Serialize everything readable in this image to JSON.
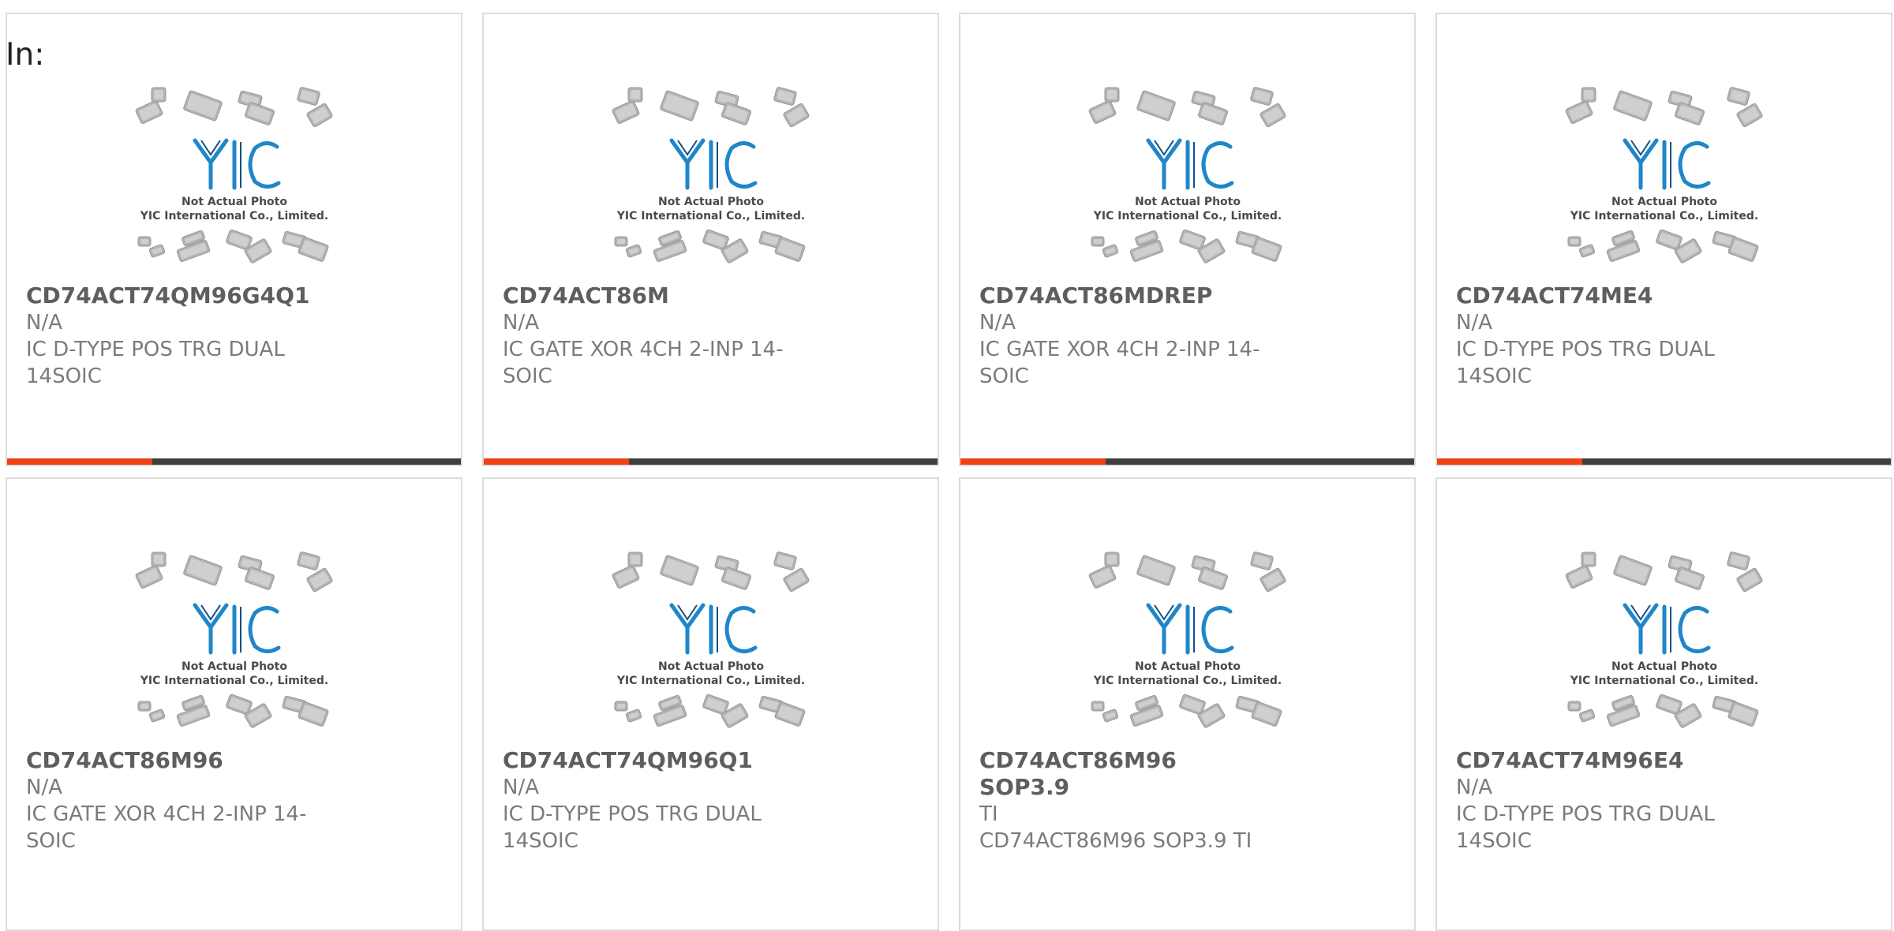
{
  "header": {
    "label": "In:"
  },
  "colors": {
    "accent": "#ee4215",
    "bar": "#3f3f3f",
    "logo_blue": "#1f86c8",
    "chip_gray": "#b3b3b3"
  },
  "thumbnail": {
    "line1": "Not Actual Photo",
    "line2": "YIC International Co., Limited."
  },
  "products": [
    {
      "part": "CD74ACT74QM96G4Q1",
      "manufacturer": "N/A",
      "description": "IC D-TYPE POS TRG DUAL 14SOIC"
    },
    {
      "part": "CD74ACT86M",
      "manufacturer": "N/A",
      "description": "IC GATE XOR 4CH 2-INP 14-SOIC"
    },
    {
      "part": "CD74ACT86MDREP",
      "manufacturer": "N/A",
      "description": "IC GATE XOR 4CH 2-INP 14-SOIC"
    },
    {
      "part": "CD74ACT74ME4",
      "manufacturer": "N/A",
      "description": "IC D-TYPE POS TRG DUAL 14SOIC"
    },
    {
      "part": "CD74ACT86M96",
      "manufacturer": "N/A",
      "description": "IC GATE XOR 4CH 2-INP 14-SOIC"
    },
    {
      "part": "CD74ACT74QM96Q1",
      "manufacturer": "N/A",
      "description": "IC D-TYPE POS TRG DUAL 14SOIC"
    },
    {
      "part": "CD74ACT86M96 SOP3.9",
      "manufacturer": "TI",
      "description": "CD74ACT86M96 SOP3.9 TI"
    },
    {
      "part": "CD74ACT74M96E4",
      "manufacturer": "N/A",
      "description": "IC D-TYPE POS TRG DUAL 14SOIC"
    }
  ]
}
